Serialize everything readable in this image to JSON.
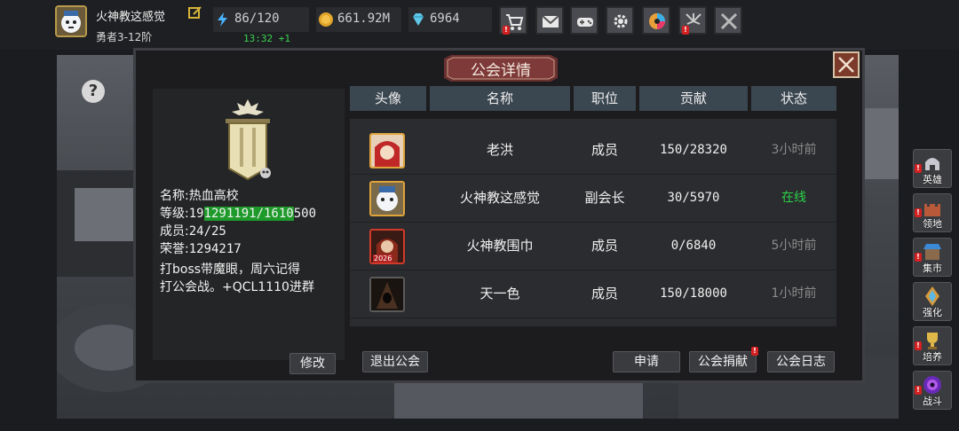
{
  "player": {
    "name": "火神教这感觉",
    "rank": "勇者3-12阶"
  },
  "resources": {
    "stamina": "86/120",
    "gold": "661.92M",
    "gems": "6964",
    "timer": "13:32 +1"
  },
  "top_menu": [
    "shop-cart-icon",
    "mail-icon",
    "gamepad-icon",
    "settings-gear-icon",
    "color-wheel-icon",
    "fireworks-icon",
    "crossed-swords-icon"
  ],
  "dialog": {
    "title": "公会详情"
  },
  "guild": {
    "name_label": "名称:",
    "name": "热血高校",
    "level_label": "等级:",
    "level_prefix": "19",
    "level_highlight": "1291191/1610",
    "level_suffix": "500",
    "members_label": "成员:",
    "members": "24/25",
    "honor_label": "荣誉:",
    "honor": "1294217",
    "notice_line1": "打boss带魔眼，周六记得",
    "notice_line2": "打公会战。+QCL1110进群",
    "edit_button": "修改",
    "leave_button": "退出公会"
  },
  "table": {
    "headers": [
      "头像",
      "名称",
      "职位",
      "贡献",
      "状态"
    ],
    "rows": [
      {
        "name": "老洪",
        "role": "成员",
        "contribution": "150/28320",
        "status": "3小时前",
        "online": false
      },
      {
        "name": "火神教这感觉",
        "role": "副会长",
        "contribution": "30/5970",
        "status": "在线",
        "online": true
      },
      {
        "name": "火神教围巾",
        "role": "成员",
        "contribution": "0/6840",
        "status": "5小时前",
        "online": false,
        "avatar_badge": "2026"
      },
      {
        "name": "天一色",
        "role": "成员",
        "contribution": "150/18000",
        "status": "1小时前",
        "online": false
      }
    ]
  },
  "actions": {
    "apply": "申请",
    "donate": "公会捐献",
    "log": "公会日志"
  },
  "side_menu": [
    "英雄",
    "领地",
    "集市",
    "强化",
    "培养",
    "战斗"
  ],
  "colors": {
    "online": "#2bd44a",
    "offline": "#8a8a8a",
    "level_highlight": "#1e9a2a",
    "header_bg": "#3a4650"
  }
}
